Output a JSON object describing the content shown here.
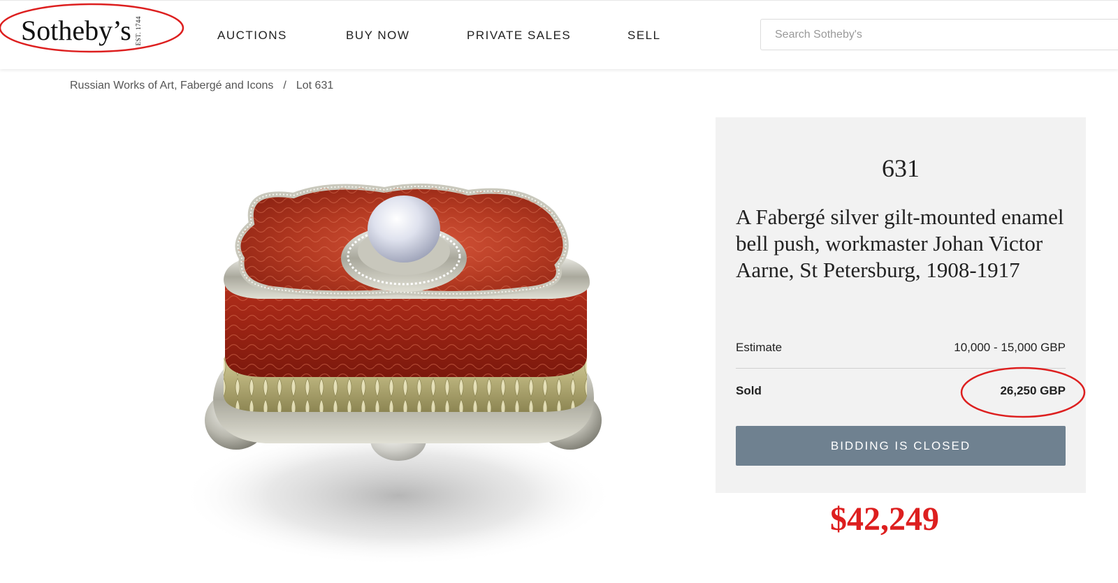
{
  "header": {
    "logo_text": "Sotheby’s",
    "logo_est": "EST. 1744",
    "nav": [
      {
        "label": "AUCTIONS"
      },
      {
        "label": "BUY NOW"
      },
      {
        "label": "PRIVATE SALES"
      },
      {
        "label": "SELL"
      }
    ],
    "search_placeholder": "Search Sotheby's"
  },
  "breadcrumb": {
    "sale": "Russian Works of Art, Fabergé and Icons",
    "separator": "/",
    "lot": "Lot 631"
  },
  "lot": {
    "number": "631",
    "title": "A Fabergé silver gilt-mounted enamel bell push, workmaster Johan Victor Aarne, St Petersburg, 1908-1917",
    "estimate_label": "Estimate",
    "estimate_value": "10,000 - 15,000 GBP",
    "sold_label": "Sold",
    "sold_value": "26,250 GBP",
    "bidding_button": "BIDDING IS CLOSED"
  },
  "annotation": {
    "usd_price": "$42,249",
    "circle_color": "#dd1f1f"
  },
  "icons": {
    "product_image": "enamel-bell-push-image"
  }
}
